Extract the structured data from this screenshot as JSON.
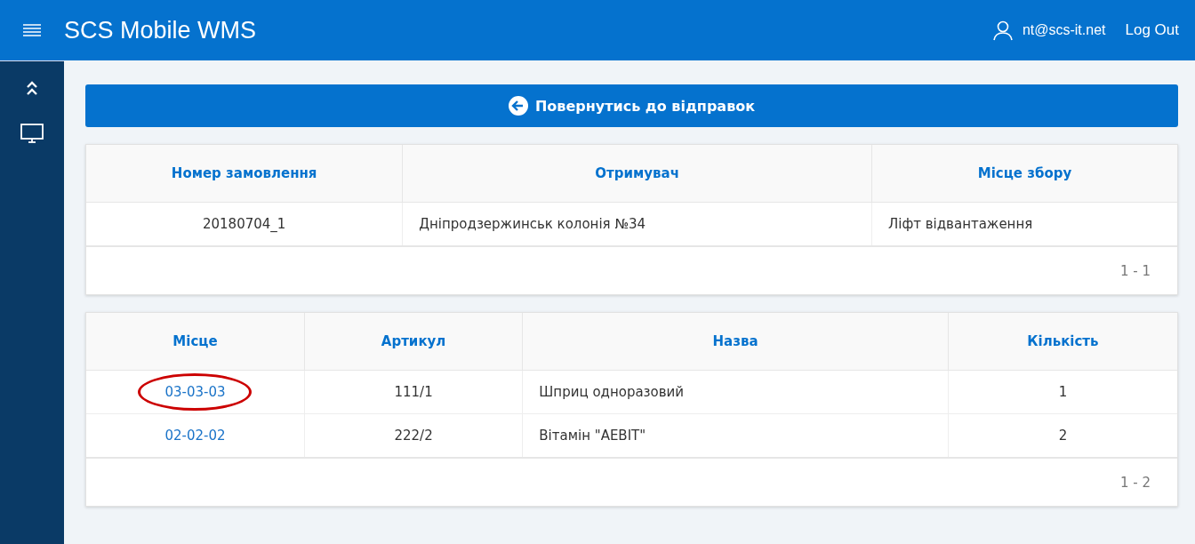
{
  "header": {
    "app_title": "SCS Mobile WMS",
    "user": "nt@scs-it.net",
    "logout": "Log Out"
  },
  "back_button": {
    "label": "Повернутись до відправок"
  },
  "order_table": {
    "columns": [
      "Номер замовлення",
      "Отримувач",
      "Місце збору"
    ],
    "rows": [
      {
        "cells": [
          "20180704_1",
          "Дніпродзержинськ колонія №34",
          "Ліфт відвантаження"
        ]
      }
    ],
    "pagination": "1 - 1"
  },
  "items_table": {
    "columns": [
      "Місце",
      "Артикул",
      "Назва",
      "Кількість"
    ],
    "rows": [
      {
        "location": "03-03-03",
        "circled": true,
        "article": "111/1",
        "name": "Шприц одноразовий",
        "quantity": "1"
      },
      {
        "location": "02-02-02",
        "circled": false,
        "article": "222/2",
        "name": "Вітамін \"AEBIT\"",
        "quantity": "2"
      }
    ],
    "pagination": "1 - 2"
  }
}
